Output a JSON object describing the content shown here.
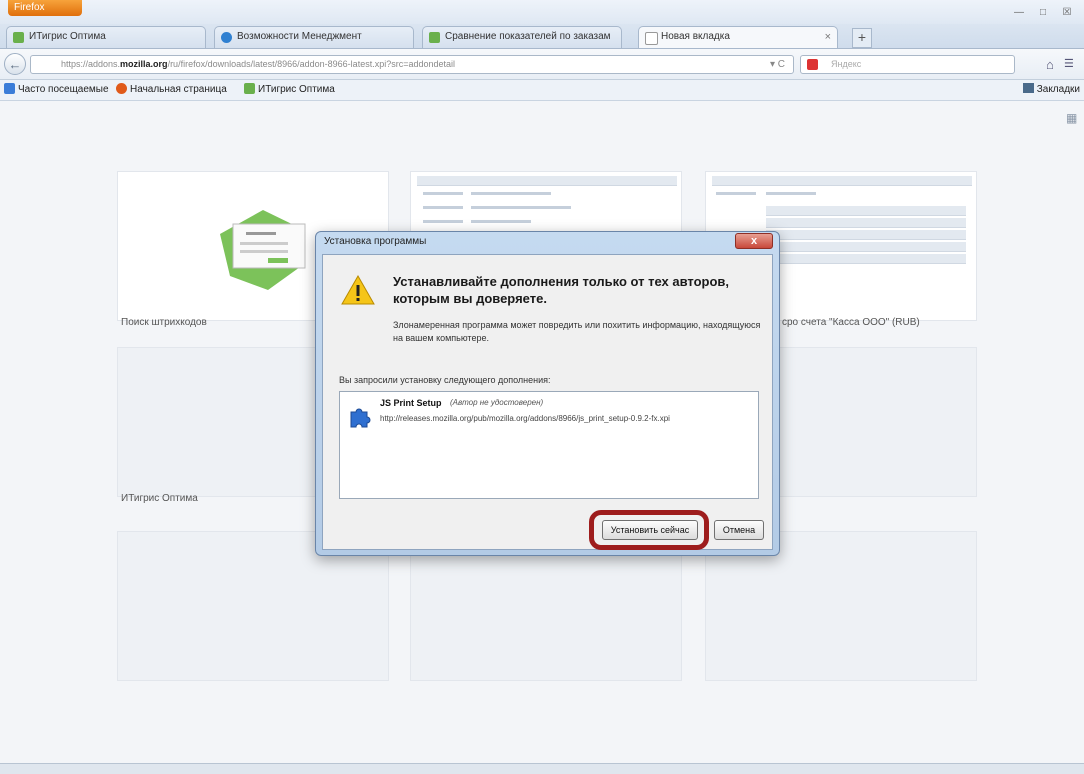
{
  "browser": {
    "menu_button": "Firefox",
    "tabs": [
      {
        "label": "ИТигрис Оптима",
        "color": "#6ab04c"
      },
      {
        "label": "Возможности Менеджмент",
        "color": "#2f80d1"
      },
      {
        "label": "Сравнение показателей по заказам",
        "color": "#6ab04c"
      },
      {
        "label": "Новая вкладка",
        "color": "#ffffff"
      }
    ],
    "url_prefix": "https://addons.",
    "url_domain": "mozilla.org",
    "url_rest": "/ru/firefox/downloads/latest/8966/addon-8966-latest.xpi?src=addondetail",
    "search_placeholder": "Яндекс",
    "bookmarks": [
      {
        "label": "Часто посещаемые",
        "color": "#3b7dd8"
      },
      {
        "label": "Начальная страница",
        "color": "#e05a1a"
      },
      {
        "label": "ИТигрис Оптима",
        "color": "#6ab04c"
      }
    ],
    "bookmarks_right": "Закладки"
  },
  "content": {
    "thumb_labels": {
      "t1": "Поиск штрихкодов",
      "t3": "сро счета \"Касса ООО\" (RUB)",
      "t4": "ИТигрис Оптима"
    }
  },
  "dialog": {
    "title": "Установка программы",
    "close": "x",
    "heading": "Устанавливайте дополнения только от тех авторов, которым вы доверяете.",
    "description": "Злонамеренная программа может повредить или похитить информацию, находящуюся на вашем компьютере.",
    "request": "Вы запросили установку следующего дополнения:",
    "addon_name": "JS Print Setup",
    "addon_author": "(Автор не удостоверен)",
    "addon_url": "http://releases.mozilla.org/pub/mozilla.org/addons/8966/js_print_setup-0.9.2-fx.xpi",
    "install_button": "Установить сейчас",
    "cancel_button": "Отмена"
  },
  "colors": {
    "highlight": "#9e1d1d",
    "firefox_orange": "#e06f0c"
  }
}
